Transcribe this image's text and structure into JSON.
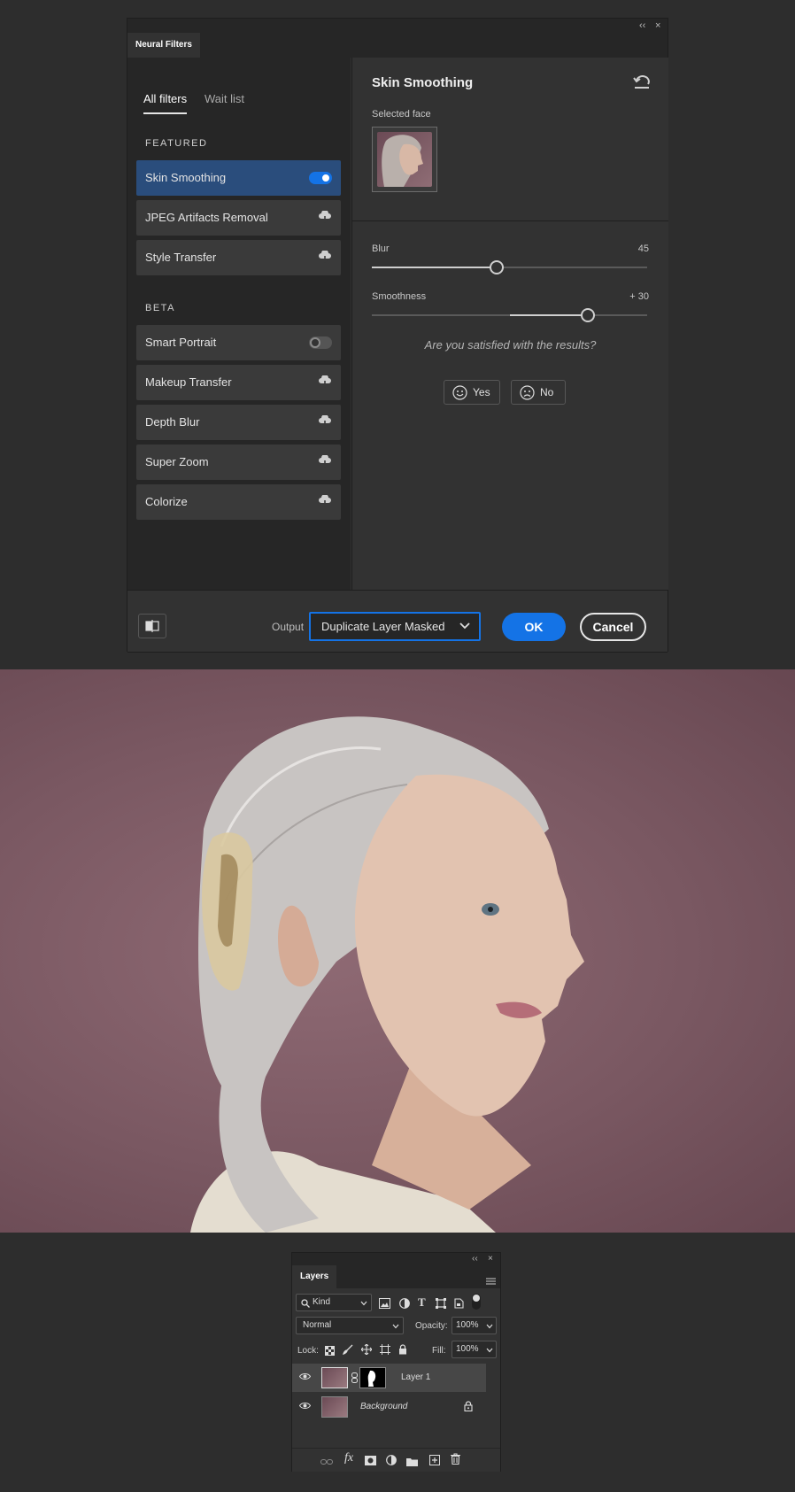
{
  "neural_filters": {
    "tab_title": "Neural Filters",
    "collapse_label": "‹‹",
    "close_label": "×",
    "tabs": [
      {
        "label": "All filters",
        "active": true
      },
      {
        "label": "Wait list",
        "active": false
      }
    ],
    "featured_heading": "FEATURED",
    "featured": [
      {
        "label": "Skin Smoothing",
        "state": "toggle-on"
      },
      {
        "label": "JPEG Artifacts Removal",
        "state": "cloud-download"
      },
      {
        "label": "Style Transfer",
        "state": "cloud-download"
      }
    ],
    "beta_heading": "BETA",
    "beta": [
      {
        "label": "Smart Portrait",
        "state": "toggle-off"
      },
      {
        "label": "Makeup Transfer",
        "state": "cloud-download"
      },
      {
        "label": "Depth Blur",
        "state": "cloud-download"
      },
      {
        "label": "Super Zoom",
        "state": "cloud-download"
      },
      {
        "label": "Colorize",
        "state": "cloud-download"
      }
    ],
    "detail": {
      "title": "Skin Smoothing",
      "selected_face_label": "Selected face",
      "sliders": [
        {
          "label": "Blur",
          "value_text": "45",
          "fraction": 0.45
        },
        {
          "label": "Smoothness",
          "value_text": "+ 30",
          "fraction": 0.78
        }
      ],
      "feedback_question": "Are you satisfied with the results?",
      "yes_label": "Yes",
      "no_label": "No"
    },
    "output_label": "Output",
    "output_value": "Duplicate Layer Masked",
    "ok_label": "OK",
    "cancel_label": "Cancel",
    "accent_color": "#1473e6"
  },
  "layers_panel": {
    "tab_title": "Layers",
    "kind_label": "Kind",
    "blend_mode": "Normal",
    "opacity_label": "Opacity:",
    "opacity_value": "100%",
    "lock_label": "Lock:",
    "fill_label": "Fill:",
    "fill_value": "100%",
    "layers": [
      {
        "name": "Layer 1",
        "selected": true,
        "has_mask": true
      },
      {
        "name": "Background",
        "selected": false,
        "locked": true
      }
    ]
  }
}
